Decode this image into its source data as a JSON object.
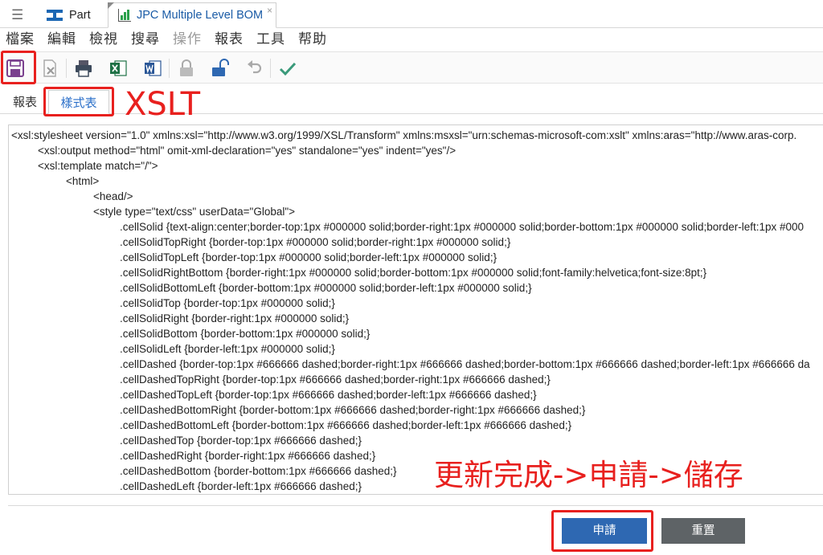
{
  "tabstrip": {
    "menu_icon": "hamburger-icon",
    "tabs": [
      {
        "label": "Part",
        "icon": "part-icon"
      },
      {
        "label": "JPC Multiple Level BOM",
        "icon": "report-chart-icon",
        "close": "×"
      }
    ]
  },
  "menu": [
    "檔案",
    "編輯",
    "檢視",
    "搜尋",
    "操作",
    "報表",
    "工具",
    "帮助"
  ],
  "toolbar": {
    "icons": [
      "save-icon",
      "close-document-icon",
      "print-icon",
      "excel-icon",
      "word-icon",
      "lock-icon",
      "unlock-icon",
      "undo-icon",
      "done-check-icon"
    ]
  },
  "subtabs": {
    "report": "報表",
    "stylesheet": "樣式表"
  },
  "code_lines": [
    "<xsl:stylesheet version=\"1.0\" xmlns:xsl=\"http://www.w3.org/1999/XSL/Transform\" xmlns:msxsl=\"urn:schemas-microsoft-com:xslt\" xmlns:aras=\"http://www.aras-corp.",
    "<xsl:output method=\"html\" omit-xml-declaration=\"yes\" standalone=\"yes\" indent=\"yes\"/>",
    "<xsl:template match=\"/\">",
    "<html>",
    "<head/>",
    "<style type=\"text/css\" userData=\"Global\">",
    ".cellSolid {text-align:center;border-top:1px #000000 solid;border-right:1px #000000 solid;border-bottom:1px #000000 solid;border-left:1px #000",
    ".cellSolidTopRight {border-top:1px #000000 solid;border-right:1px #000000 solid;}",
    ".cellSolidTopLeft {border-top:1px #000000 solid;border-left:1px #000000 solid;}",
    ".cellSolidRightBottom {border-right:1px #000000 solid;border-bottom:1px #000000 solid;font-family:helvetica;font-size:8pt;}",
    ".cellSolidBottomLeft {border-bottom:1px #000000 solid;border-left:1px #000000 solid;}",
    ".cellSolidTop {border-top:1px #000000 solid;}",
    ".cellSolidRight {border-right:1px #000000 solid;}",
    ".cellSolidBottom {border-bottom:1px #000000 solid;}",
    ".cellSolidLeft {border-left:1px #000000 solid;}",
    ".cellDashed {border-top:1px #666666 dashed;border-right:1px #666666 dashed;border-bottom:1px #666666 dashed;border-left:1px #666666 da",
    ".cellDashedTopRight {border-top:1px #666666 dashed;border-right:1px #666666 dashed;}",
    ".cellDashedTopLeft {border-top:1px #666666 dashed;border-left:1px #666666 dashed;}",
    ".cellDashedBottomRight {border-bottom:1px #666666 dashed;border-right:1px #666666 dashed;}",
    ".cellDashedBottomLeft {border-bottom:1px #666666 dashed;border-left:1px #666666 dashed;}",
    ".cellDashedTop {border-top:1px #666666 dashed;}",
    ".cellDashedRight {border-right:1px #666666 dashed;}",
    ".cellDashedBottom {border-bottom:1px #666666 dashed;}",
    ".cellDashedLeft {border-left:1px #666666 dashed;}"
  ],
  "buttons": {
    "apply": "申請",
    "reset": "重置"
  },
  "annotations": {
    "xslt": "XSLT",
    "steps": "更新完成->申請->儲存"
  },
  "colors": {
    "accent_blue": "#2e68b2",
    "annotation_red": "#e8201e",
    "reset_gray": "#5e6366"
  }
}
